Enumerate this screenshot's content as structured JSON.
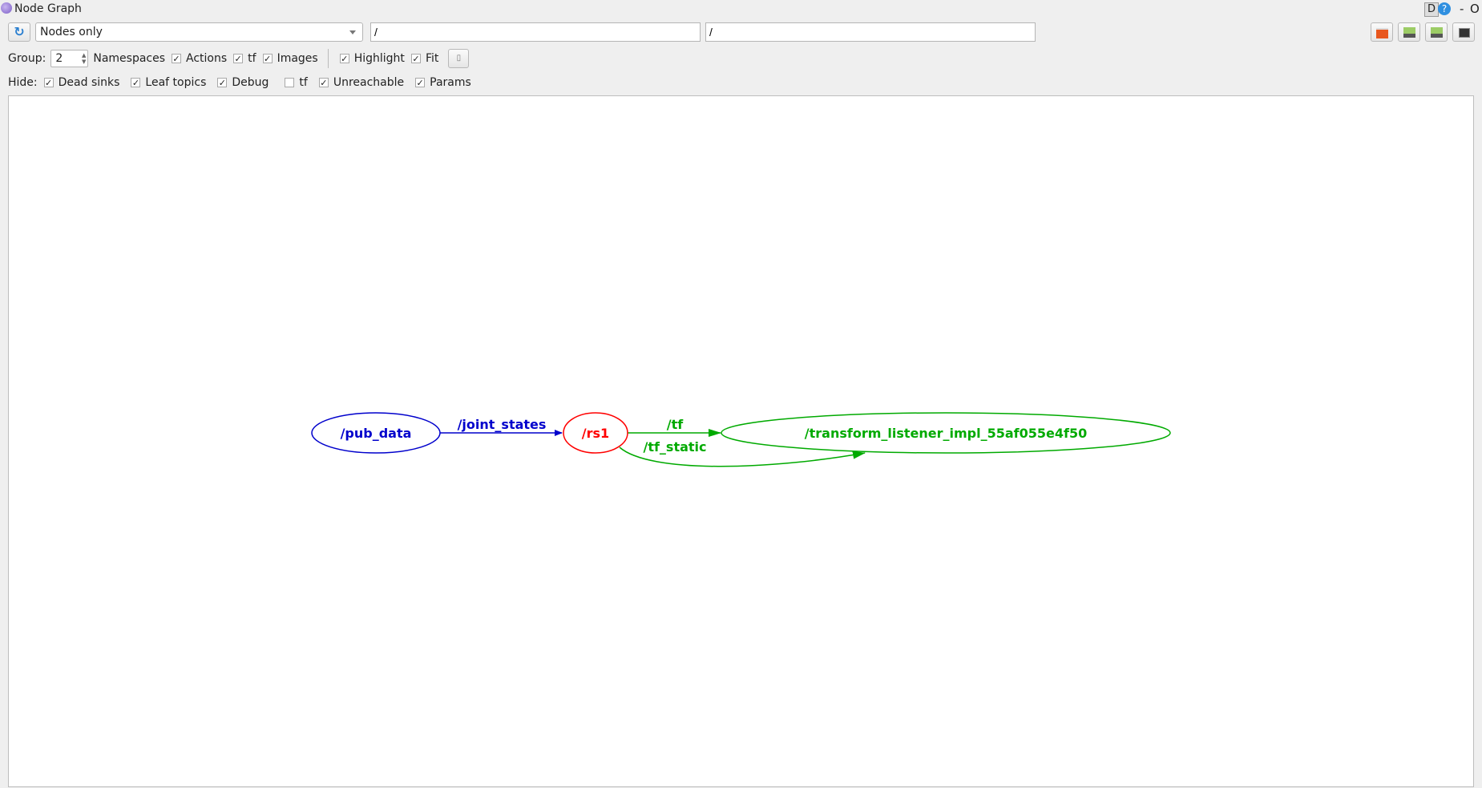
{
  "window": {
    "title": "Node Graph",
    "corner_d": "D",
    "corner_help": "?",
    "corner_minimize": "-",
    "corner_close": "O"
  },
  "toolbar": {
    "refresh_icon": "refresh-icon",
    "graph_type": "Nodes only",
    "filter_nodes": "/",
    "filter_topics": "/",
    "right_buttons": [
      "load-dot-icon",
      "save-dot-icon",
      "save-svg-icon",
      "save-image-icon"
    ]
  },
  "options": {
    "group_label": "Group:",
    "group_value": "2",
    "items": [
      {
        "label": "Namespaces",
        "has_checkbox": false
      },
      {
        "label": "Actions",
        "checked": true
      },
      {
        "label": "tf",
        "checked": true
      },
      {
        "label": "Images",
        "checked": true
      }
    ],
    "highlight": {
      "label": "Highlight",
      "checked": true
    },
    "fit": {
      "label": "Fit",
      "checked": true
    },
    "fit_button_icon": "fit-view-icon"
  },
  "hide": {
    "label": "Hide:",
    "items": [
      {
        "label": "Dead sinks",
        "checked": true
      },
      {
        "label": "Leaf topics",
        "checked": true
      },
      {
        "label": "Debug",
        "checked": true
      },
      {
        "label": "tf",
        "checked": false
      },
      {
        "label": "Unreachable",
        "checked": true
      },
      {
        "label": "Params",
        "checked": true
      }
    ]
  },
  "graph": {
    "colors": {
      "blue": "#0000cc",
      "red": "#ff0000",
      "green": "#00aa00"
    },
    "nodes": {
      "pub_data": "/pub_data",
      "rs1": "/rs1",
      "listener": "/transform_listener_impl_55af055e4f50"
    },
    "edges": {
      "joint_states": "/joint_states",
      "tf": "/tf",
      "tf_static": "/tf_static"
    }
  }
}
